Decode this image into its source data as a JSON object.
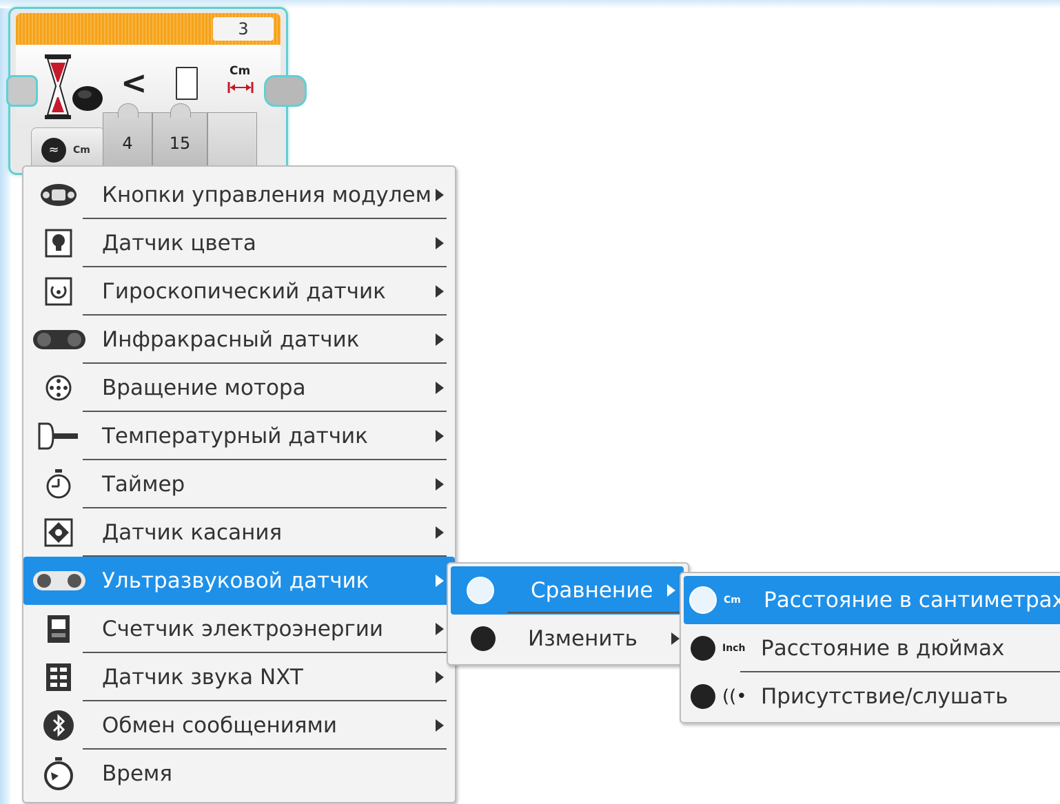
{
  "block": {
    "number": "3",
    "comparison_sign": "<",
    "unit_label": "Cm",
    "mode_unit": "Cm",
    "params": [
      "4",
      "15"
    ]
  },
  "menu_main": {
    "items": [
      {
        "label": "Кнопки управления модулем",
        "icon": "brick-buttons-icon"
      },
      {
        "label": "Датчик цвета",
        "icon": "color-sensor-icon"
      },
      {
        "label": "Гироскопический датчик",
        "icon": "gyro-sensor-icon"
      },
      {
        "label": "Инфракрасный датчик",
        "icon": "infrared-sensor-icon"
      },
      {
        "label": "Вращение мотора",
        "icon": "motor-rotation-icon"
      },
      {
        "label": "Температурный датчик",
        "icon": "temperature-sensor-icon"
      },
      {
        "label": "Таймер",
        "icon": "timer-icon"
      },
      {
        "label": "Датчик касания",
        "icon": "touch-sensor-icon"
      },
      {
        "label": "Ультразвуковой датчик",
        "icon": "ultrasonic-sensor-icon"
      },
      {
        "label": "Счетчик электроэнергии",
        "icon": "energy-meter-icon"
      },
      {
        "label": "Датчик звука NXT",
        "icon": "sound-sensor-icon"
      },
      {
        "label": "Обмен сообщениями",
        "icon": "bluetooth-icon"
      },
      {
        "label": "Время",
        "icon": "time-icon"
      }
    ],
    "selected": "Ультразвуковой датчик"
  },
  "menu_sub": {
    "items": [
      {
        "label": "Сравнение",
        "icon": "compare-icon"
      },
      {
        "label": "Изменить",
        "icon": "change-icon"
      }
    ],
    "selected": "Сравнение"
  },
  "menu_modes": {
    "items": [
      {
        "label": "Расстояние в сантиметрах",
        "unit": "Cm",
        "icon": "compare-icon"
      },
      {
        "label": "Расстояние в дюймах",
        "unit": "Inch",
        "icon": "compare-icon"
      },
      {
        "label": "Присутствие/слушать",
        "unit": "",
        "icon": "listen-icon"
      }
    ],
    "selected": "Расстояние в сантиметрах"
  },
  "colors": {
    "selection": "#1e90e8",
    "block_border": "#5fd0d6",
    "header_orange": "#f6a21a"
  }
}
